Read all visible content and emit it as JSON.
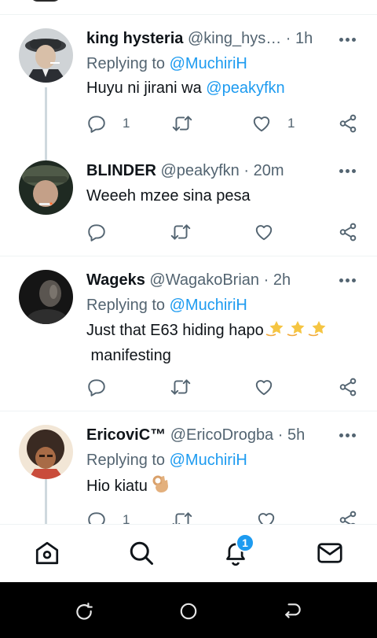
{
  "tweets": [
    {
      "name": "king hysteria",
      "handle": "@king_hys…",
      "sep": "·",
      "time": "1h",
      "replying_prefix": "Replying to",
      "replying_to": "@MuchiriH",
      "text": "Huyu ni jirani wa ",
      "text_mention": "@peakyfkn",
      "reply_count": "1",
      "like_count": "1"
    },
    {
      "name": "BLINDER",
      "handle": "@peakyfkn",
      "sep": "·",
      "time": "20m",
      "text": "Weeeh mzee sina pesa"
    },
    {
      "name": "Wageks",
      "handle": "@WagakoBrian",
      "sep": "·",
      "time": "2h",
      "replying_prefix": "Replying to",
      "replying_to": "@MuchiriH",
      "text_line1": "Just that E63 hiding hapo",
      "text_line2": " manifesting"
    },
    {
      "name": "EricoviC™",
      "handle": "@EricoDrogba",
      "sep": "·",
      "time": "5h",
      "replying_prefix": "Replying to",
      "replying_to": "@MuchiriH",
      "text": "Hio kiatu",
      "reply_count": "1"
    }
  ],
  "bottom_nav": {
    "items": [
      "home-icon",
      "search-icon",
      "notifications-icon",
      "messages-icon"
    ],
    "notification_badge": "1"
  },
  "system_nav": [
    "recent-apps-icon",
    "home-circle-icon",
    "back-icon"
  ],
  "colors": {
    "accent": "#1d9bf0",
    "secondary_text": "#536471",
    "primary_text": "#0f1419",
    "thread_line": "#cfd9de",
    "emoji_star": "#f5c542"
  }
}
